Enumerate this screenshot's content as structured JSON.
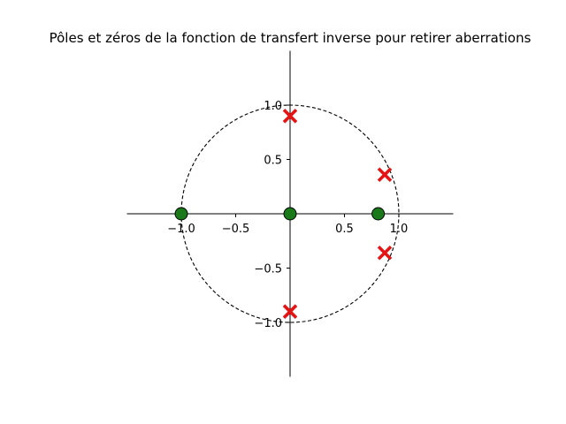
{
  "chart_data": {
    "type": "scatter",
    "title": "Pôles et zéros de la fonction de transfert inverse pour retirer aberrations",
    "xlabel": "",
    "ylabel": "",
    "xlim": [
      -1.5,
      1.5
    ],
    "ylim": [
      -1.5,
      1.5
    ],
    "x_ticks": [
      {
        "value": -1.0,
        "label": "−1.0"
      },
      {
        "value": -0.5,
        "label": "−0.5"
      },
      {
        "value": 0.5,
        "label": "0.5"
      },
      {
        "value": 1.0,
        "label": "1.0"
      }
    ],
    "y_ticks": [
      {
        "value": 1.0,
        "label": "1.0"
      },
      {
        "value": 0.5,
        "label": "0.5"
      },
      {
        "value": -0.5,
        "label": "−0.5"
      },
      {
        "value": -1.0,
        "label": "−1.0"
      }
    ],
    "unit_circle": {
      "radius": 1.0,
      "style": "dashed",
      "color": "#000000"
    },
    "grid": false,
    "series": [
      {
        "marker": "circle",
        "color": "#1a7a1a",
        "points": [
          {
            "x": -1.0,
            "y": 0.0
          },
          {
            "x": 0.0,
            "y": 0.0
          },
          {
            "x": 0.81,
            "y": 0.0
          }
        ]
      },
      {
        "marker": "x",
        "color": "#e41414",
        "points": [
          {
            "x": 0.0,
            "y": 0.9
          },
          {
            "x": 0.0,
            "y": -0.9
          },
          {
            "x": 0.87,
            "y": 0.36
          },
          {
            "x": 0.87,
            "y": -0.36
          }
        ]
      }
    ]
  }
}
